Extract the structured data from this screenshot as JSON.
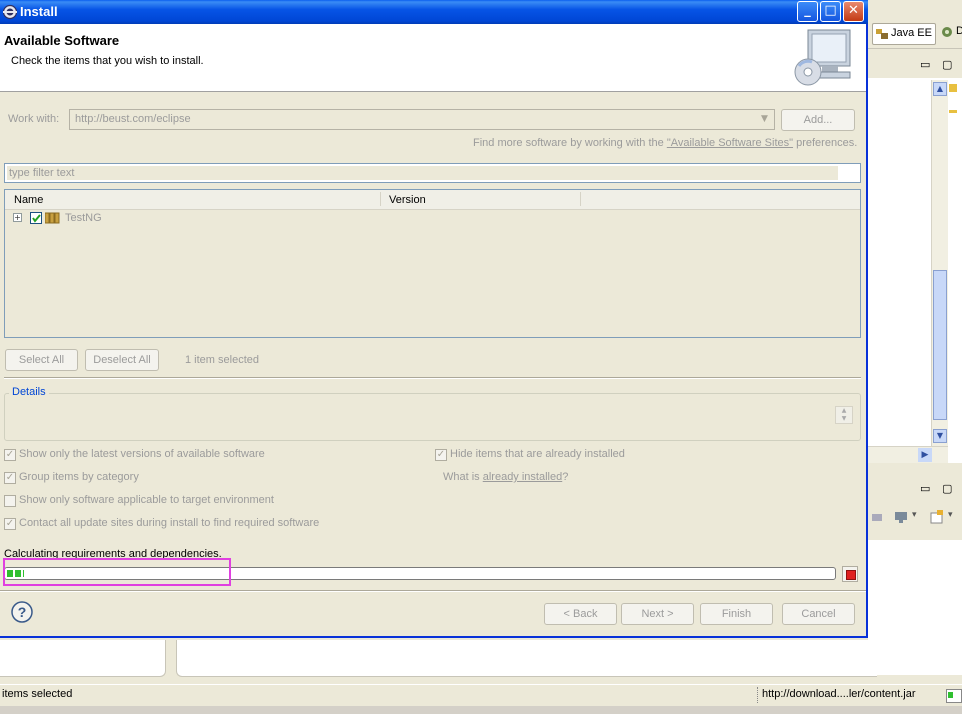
{
  "dialog": {
    "title": "Install",
    "header_title": "Available Software",
    "header_description": "Check the items that you wish to install.",
    "work_with_label": "Work with:",
    "work_with_value": "http://beust.com/eclipse",
    "add_button": "Add...",
    "sites_text_prefix": "Find more software by working with the ",
    "sites_link": "\"Available Software Sites\"",
    "sites_text_suffix": " preferences.",
    "filter_placeholder": "type filter text",
    "table": {
      "columns": [
        "Name",
        "Version"
      ],
      "rows": [
        {
          "name": "TestNG",
          "version": "",
          "checked": true
        }
      ]
    },
    "select_all": "Select All",
    "deselect_all": "Deselect All",
    "selection_count": "1 item selected",
    "details_label": "Details",
    "options": {
      "latest_versions": "Show only the latest versions of available software",
      "group_by_category": "Group items by category",
      "target_environment": "Show only software applicable to target environment",
      "contact_sites": "Contact all update sites during install to find required software",
      "hide_installed": "Hide items that are already installed",
      "what_is_prefix": "What is ",
      "already_installed_link": "already installed",
      "what_is_suffix": "?"
    },
    "progress_message": "Calculating requirements and dependencies.",
    "progress_fraction": 0.02,
    "buttons": {
      "back": "< Back",
      "next": "Next >",
      "finish": "Finish",
      "cancel": "Cancel"
    }
  },
  "background": {
    "perspective_label": "Java EE",
    "perspective_label_2": "D",
    "status_left": "items selected",
    "status_right": "http://download....ler/content.jar"
  },
  "colors": {
    "titlebar": "#0054e3",
    "highlight": "#e040e0",
    "progress_green": "#2fbf2f"
  }
}
